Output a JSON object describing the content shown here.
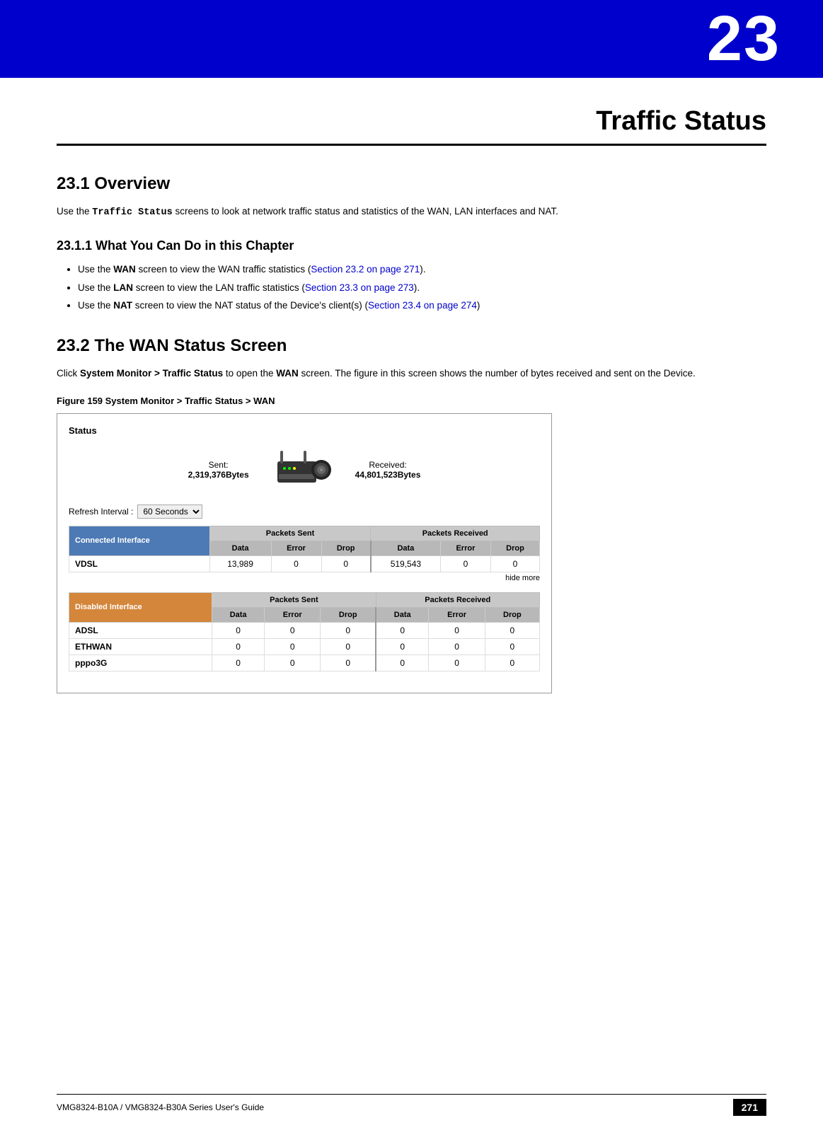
{
  "header": {
    "chapter_number": "23",
    "chapter_bg": "#0000cc"
  },
  "title": "Traffic Status",
  "sections": {
    "overview": {
      "heading": "23.1  Overview",
      "body": "Use the Traffic Status screens to look at network traffic status and statistics of the WAN, LAN interfaces and NAT.",
      "bold_term": "Traffic Status"
    },
    "what_you_can_do": {
      "heading": "23.1.1  What You Can Do in this Chapter",
      "items": [
        {
          "text": "Use the WAN screen to view the WAN traffic statistics (",
          "bold": "WAN",
          "link_text": "Section 23.2 on page 271",
          "suffix": ")."
        },
        {
          "text": "Use the LAN screen to view the LAN traffic statistics (",
          "bold": "LAN",
          "link_text": "Section 23.3 on page 273",
          "suffix": ")."
        },
        {
          "text": "Use the NAT screen to view the NAT status of the Device's client(s) (",
          "bold": "NAT",
          "link_text": "Section 23.4 on page 274",
          "suffix": ")"
        }
      ]
    },
    "wan_status": {
      "heading": "23.2  The WAN Status Screen",
      "body_before_bold": "Click ",
      "bold1": "System Monitor > Traffic Status",
      "body_after_bold": " to open the WAN screen. The figure in this screen shows the number of bytes received and sent on the Device.",
      "bold2": "WAN"
    },
    "figure": {
      "label": "Figure 159   System Monitor > Traffic Status > WAN",
      "screen": {
        "title": "Status",
        "sent_label": "Sent:",
        "sent_value": "2,319,376",
        "sent_unit": "Bytes",
        "received_label": "Received:",
        "received_value": "44,801,523",
        "received_unit": "Bytes",
        "refresh_label": "Refresh Interval :",
        "refresh_value": "60 Seconds",
        "connected_table": {
          "header": "Connected Interface",
          "packets_sent": "Packets Sent",
          "packets_received": "Packets Received",
          "columns": [
            "Data",
            "Error",
            "Drop",
            "Data",
            "Error",
            "Drop"
          ],
          "rows": [
            {
              "name": "VDSL",
              "sent_data": "13,989",
              "sent_error": "0",
              "sent_drop": "0",
              "recv_data": "519,543",
              "recv_error": "0",
              "recv_drop": "0"
            }
          ]
        },
        "hide_more": "hide more",
        "disabled_table": {
          "header": "Disabled Interface",
          "packets_sent": "Packets Sent",
          "packets_received": "Packets Received",
          "columns": [
            "Data",
            "Error",
            "Drop",
            "Data",
            "Error",
            "Drop"
          ],
          "rows": [
            {
              "name": "ADSL",
              "sent_data": "0",
              "sent_error": "0",
              "sent_drop": "0",
              "recv_data": "0",
              "recv_error": "0",
              "recv_drop": "0"
            },
            {
              "name": "ETHWAN",
              "sent_data": "0",
              "sent_error": "0",
              "sent_drop": "0",
              "recv_data": "0",
              "recv_error": "0",
              "recv_drop": "0"
            },
            {
              "name": "pppo3G",
              "sent_data": "0",
              "sent_error": "0",
              "sent_drop": "0",
              "recv_data": "0",
              "recv_error": "0",
              "recv_drop": "0"
            }
          ]
        }
      }
    }
  },
  "footer": {
    "left_text": "VMG8324-B10A / VMG8324-B30A Series User's Guide",
    "page_number": "271"
  },
  "links": {
    "section_23_2": "Section 23.2 on page 271",
    "section_23_3": "Section 23.3 on page 273",
    "section_23_4": "Section 23.4 on page 274"
  }
}
